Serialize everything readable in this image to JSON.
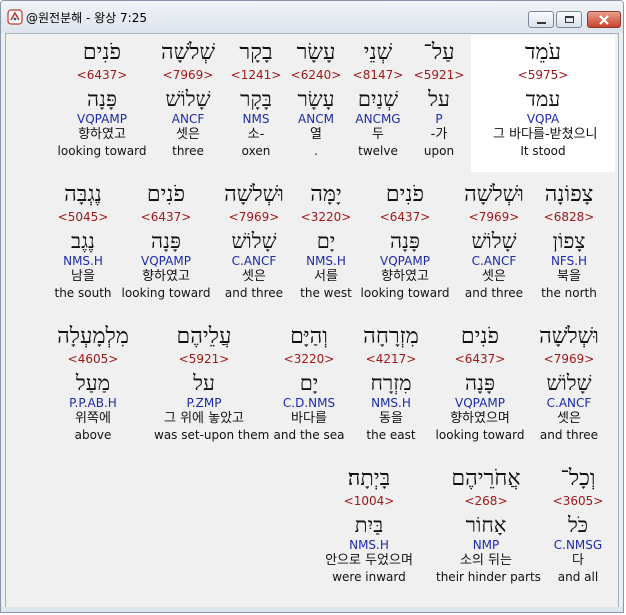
{
  "window": {
    "title": "@원전분해 - 왕상 7:25",
    "icons": {
      "app": "app-logo-icon",
      "minimize": "minimize-icon",
      "maximize": "maximize-icon",
      "close": "close-icon"
    }
  },
  "rows": [
    [
      {
        "heb": "עֹמֵד",
        "num": "<5975>",
        "root": "עמד",
        "parse": "VQPA",
        "ko": "그 바다를-받쳤으니",
        "en": "It stood"
      },
      {
        "heb": "עַל־",
        "num": "<5921>",
        "root": "על",
        "parse": "P",
        "ko": "-가",
        "en": "upon"
      },
      {
        "heb": "שְׁנֵי",
        "num": "<8147>",
        "root": "שְׁנַיִם",
        "parse": "ANCMG",
        "ko": "두",
        "en": "twelve"
      },
      {
        "heb": "עָשָׂר",
        "num": "<6240>",
        "root": "עָשָׂר",
        "parse": "ANCM",
        "ko": "열",
        "en": "."
      },
      {
        "heb": "בָקָר",
        "num": "<1241>",
        "root": "בָּקָר",
        "parse": "NMS",
        "ko": "소-",
        "en": "oxen"
      },
      {
        "heb": "שְׁלֹשָׁה",
        "num": "<7969>",
        "root": "שָׁלוֹשׁ",
        "parse": "ANCF",
        "ko": "셋은",
        "en": "three"
      },
      {
        "heb": "פֹנִים",
        "num": "<6437>",
        "root": "פָּנָה",
        "parse": "VQPAMP",
        "ko": "향하였고",
        "en": "looking toward"
      }
    ],
    [
      {
        "heb": "צָפוֹנָה",
        "num": "<6828>",
        "root": "צָפוֹן",
        "parse": "NFS.H",
        "ko": "북을",
        "en": "the north"
      },
      {
        "heb": "וּשְׁלֹשָׁה",
        "num": "<7969>",
        "root": "שָׁלוֹשׁ",
        "parse": "C.ANCF",
        "ko": "셋은",
        "en": "and three"
      },
      {
        "heb": "פֹנִים",
        "num": "<6437>",
        "root": "פָּנָה",
        "parse": "VQPAMP",
        "ko": "향하였고",
        "en": "looking toward"
      },
      {
        "heb": "יָמָּה",
        "num": "<3220>",
        "root": "יָם",
        "parse": "NMS.H",
        "ko": "서를",
        "en": "the west"
      },
      {
        "heb": "וּשְׁלֹשָׁה",
        "num": "<7969>",
        "root": "שָׁלוֹשׁ",
        "parse": "C.ANCF",
        "ko": "셋은",
        "en": "and three"
      },
      {
        "heb": "פֹנִים",
        "num": "<6437>",
        "root": "פָּנָה",
        "parse": "VQPAMP",
        "ko": "향하였고",
        "en": "looking toward"
      },
      {
        "heb": "נֶגְבָּה",
        "num": "<5045>",
        "root": "נֶגֶב",
        "parse": "NMS.H",
        "ko": "남을",
        "en": "the south"
      }
    ],
    [
      {
        "heb": "וּשְׁלֹשָׁה",
        "num": "<7969>",
        "root": "שָׁלוֹשׁ",
        "parse": "C.ANCF",
        "ko": "셋은",
        "en": "and three"
      },
      {
        "heb": "פֹנִים",
        "num": "<6437>",
        "root": "פָּנָה",
        "parse": "VQPAMP",
        "ko": "향하였으며",
        "en": "looking toward"
      },
      {
        "heb": "מִזְרָחָה",
        "num": "<4217>",
        "root": "מִזְרָח",
        "parse": "NMS.H",
        "ko": "동을",
        "en": "the east"
      },
      {
        "heb": "וְהַיָּם",
        "num": "<3220>",
        "root": "יָם",
        "parse": "C.D.NMS",
        "ko": "바다를",
        "en": "and the sea"
      },
      {
        "heb": "עֲלֵיהֶם",
        "num": "<5921>",
        "root": "על",
        "parse": "P.ZMP",
        "ko": "그 위에 놓았고",
        "en": "was set-upon them"
      },
      {
        "heb": "מִלְמָעְלָה",
        "num": "<4605>",
        "root": "מַעַל",
        "parse": "P.P.AB.H",
        "ko": "위쪽에",
        "en": "above"
      }
    ],
    [
      {
        "heb": "וְכָל־",
        "num": "<3605>",
        "root": "כֹּל",
        "parse": "C.NMSG",
        "ko": "다",
        "en": "and all"
      },
      {
        "heb": "אֲחֹרֵיהֶם",
        "num": "<268>",
        "root": "אָחוֹר",
        "parse": "NMP",
        "ko": "소의 뒤는",
        "en": "their hinder parts"
      },
      {
        "heb": "בָּיְתָה׃",
        "num": "<1004>",
        "root": "בַּיִת",
        "parse": "NMS.H",
        "ko": "안으로 두었으며",
        "en": "were inward"
      }
    ]
  ]
}
